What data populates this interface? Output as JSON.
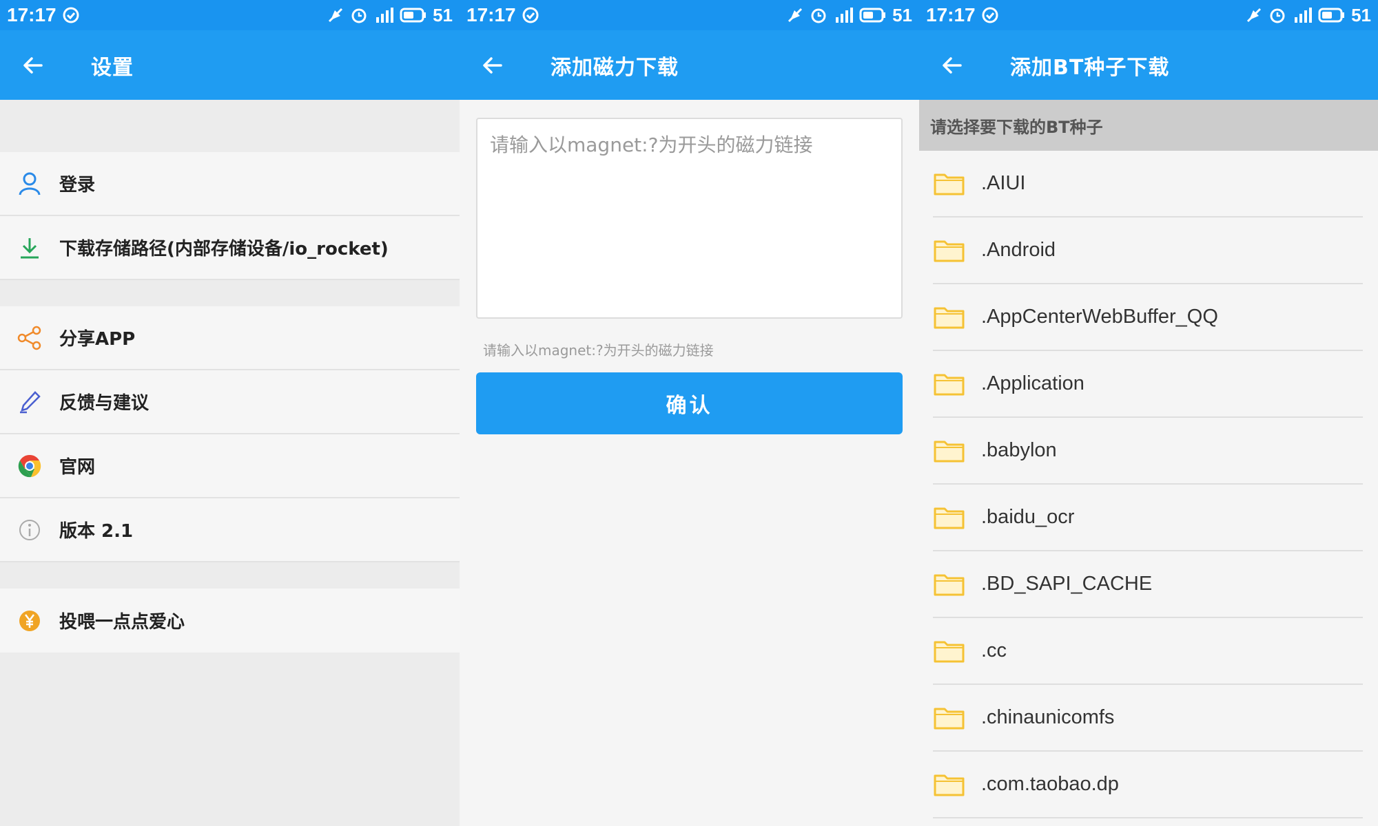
{
  "status_bars": [
    {
      "time": "17:17",
      "battery": "51"
    },
    {
      "time": "17:17",
      "battery": "51"
    },
    {
      "time": "17:17",
      "battery": "51"
    }
  ],
  "colors": {
    "primary": "#1f9cf2",
    "status_bar": "#1994f0",
    "menu_bg": "#f6f6f6",
    "gap_bg": "#ececec",
    "folder": "#f7c948"
  },
  "settings": {
    "title": "设置",
    "back_icon": "arrow-left-icon",
    "items": [
      {
        "label": "登录",
        "icon": "user-icon"
      },
      {
        "label": "下载存储路径(内部存储设备/io_rocket)",
        "icon": "download-icon"
      },
      {
        "label": "分享APP",
        "icon": "share-icon"
      },
      {
        "label": "反馈与建议",
        "icon": "pen-icon"
      },
      {
        "label": "官网",
        "icon": "chrome-icon"
      },
      {
        "label": "版本 2.1",
        "icon": "info-icon"
      },
      {
        "label": "投喂一点点爱心",
        "icon": "yen-coin-icon"
      }
    ]
  },
  "magnet": {
    "title": "添加磁力下载",
    "placeholder": "请输入以magnet:?为开头的磁力链接",
    "hint": "请输入以magnet:?为开头的磁力链接",
    "confirm_label": "确认"
  },
  "bt": {
    "title": "添加BT种子下载",
    "section_header": "请选择要下载的BT种子",
    "folder_icon": "folder-icon",
    "folders": [
      ".AIUI",
      ".Android",
      ".AppCenterWebBuffer_QQ",
      ".Application",
      ".babylon",
      ".baidu_ocr",
      ".BD_SAPI_CACHE",
      ".cc",
      ".chinaunicomfs",
      ".com.taobao.dp"
    ]
  }
}
